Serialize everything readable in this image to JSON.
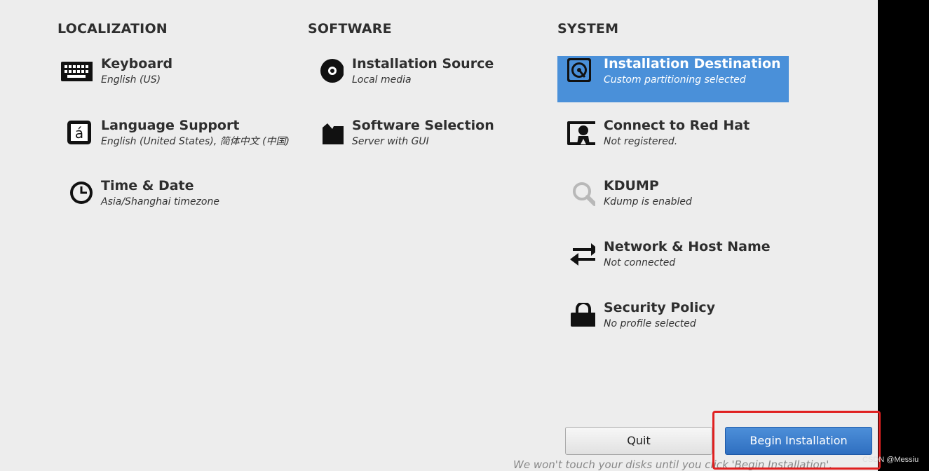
{
  "columns": {
    "localization": "LOCALIZATION",
    "software": "SOFTWARE",
    "system": "SYSTEM"
  },
  "spokes": {
    "keyboard": {
      "title": "Keyboard",
      "status": "English (US)"
    },
    "language": {
      "title": "Language Support",
      "status": "English (United States), 简体中文 (中国)"
    },
    "time": {
      "title": "Time & Date",
      "status": "Asia/Shanghai timezone"
    },
    "source": {
      "title": "Installation Source",
      "status": "Local media"
    },
    "selection": {
      "title": "Software Selection",
      "status": "Server with GUI"
    },
    "destination": {
      "title": "Installation Destination",
      "status": "Custom partitioning selected"
    },
    "redhat": {
      "title": "Connect to Red Hat",
      "status": "Not registered."
    },
    "kdump": {
      "title": "KDUMP",
      "status": "Kdump is enabled"
    },
    "network": {
      "title": "Network & Host Name",
      "status": "Not connected"
    },
    "security": {
      "title": "Security Policy",
      "status": "No profile selected"
    }
  },
  "buttons": {
    "quit": "Quit",
    "begin": "Begin Installation"
  },
  "footnote": "We won't touch your disks until you click 'Begin Installation'.",
  "watermark": "CSDN @Messiu",
  "colors": {
    "selected": "#4a90d9",
    "begin_button": "#3a7fcf",
    "highlight": "#e02020"
  }
}
